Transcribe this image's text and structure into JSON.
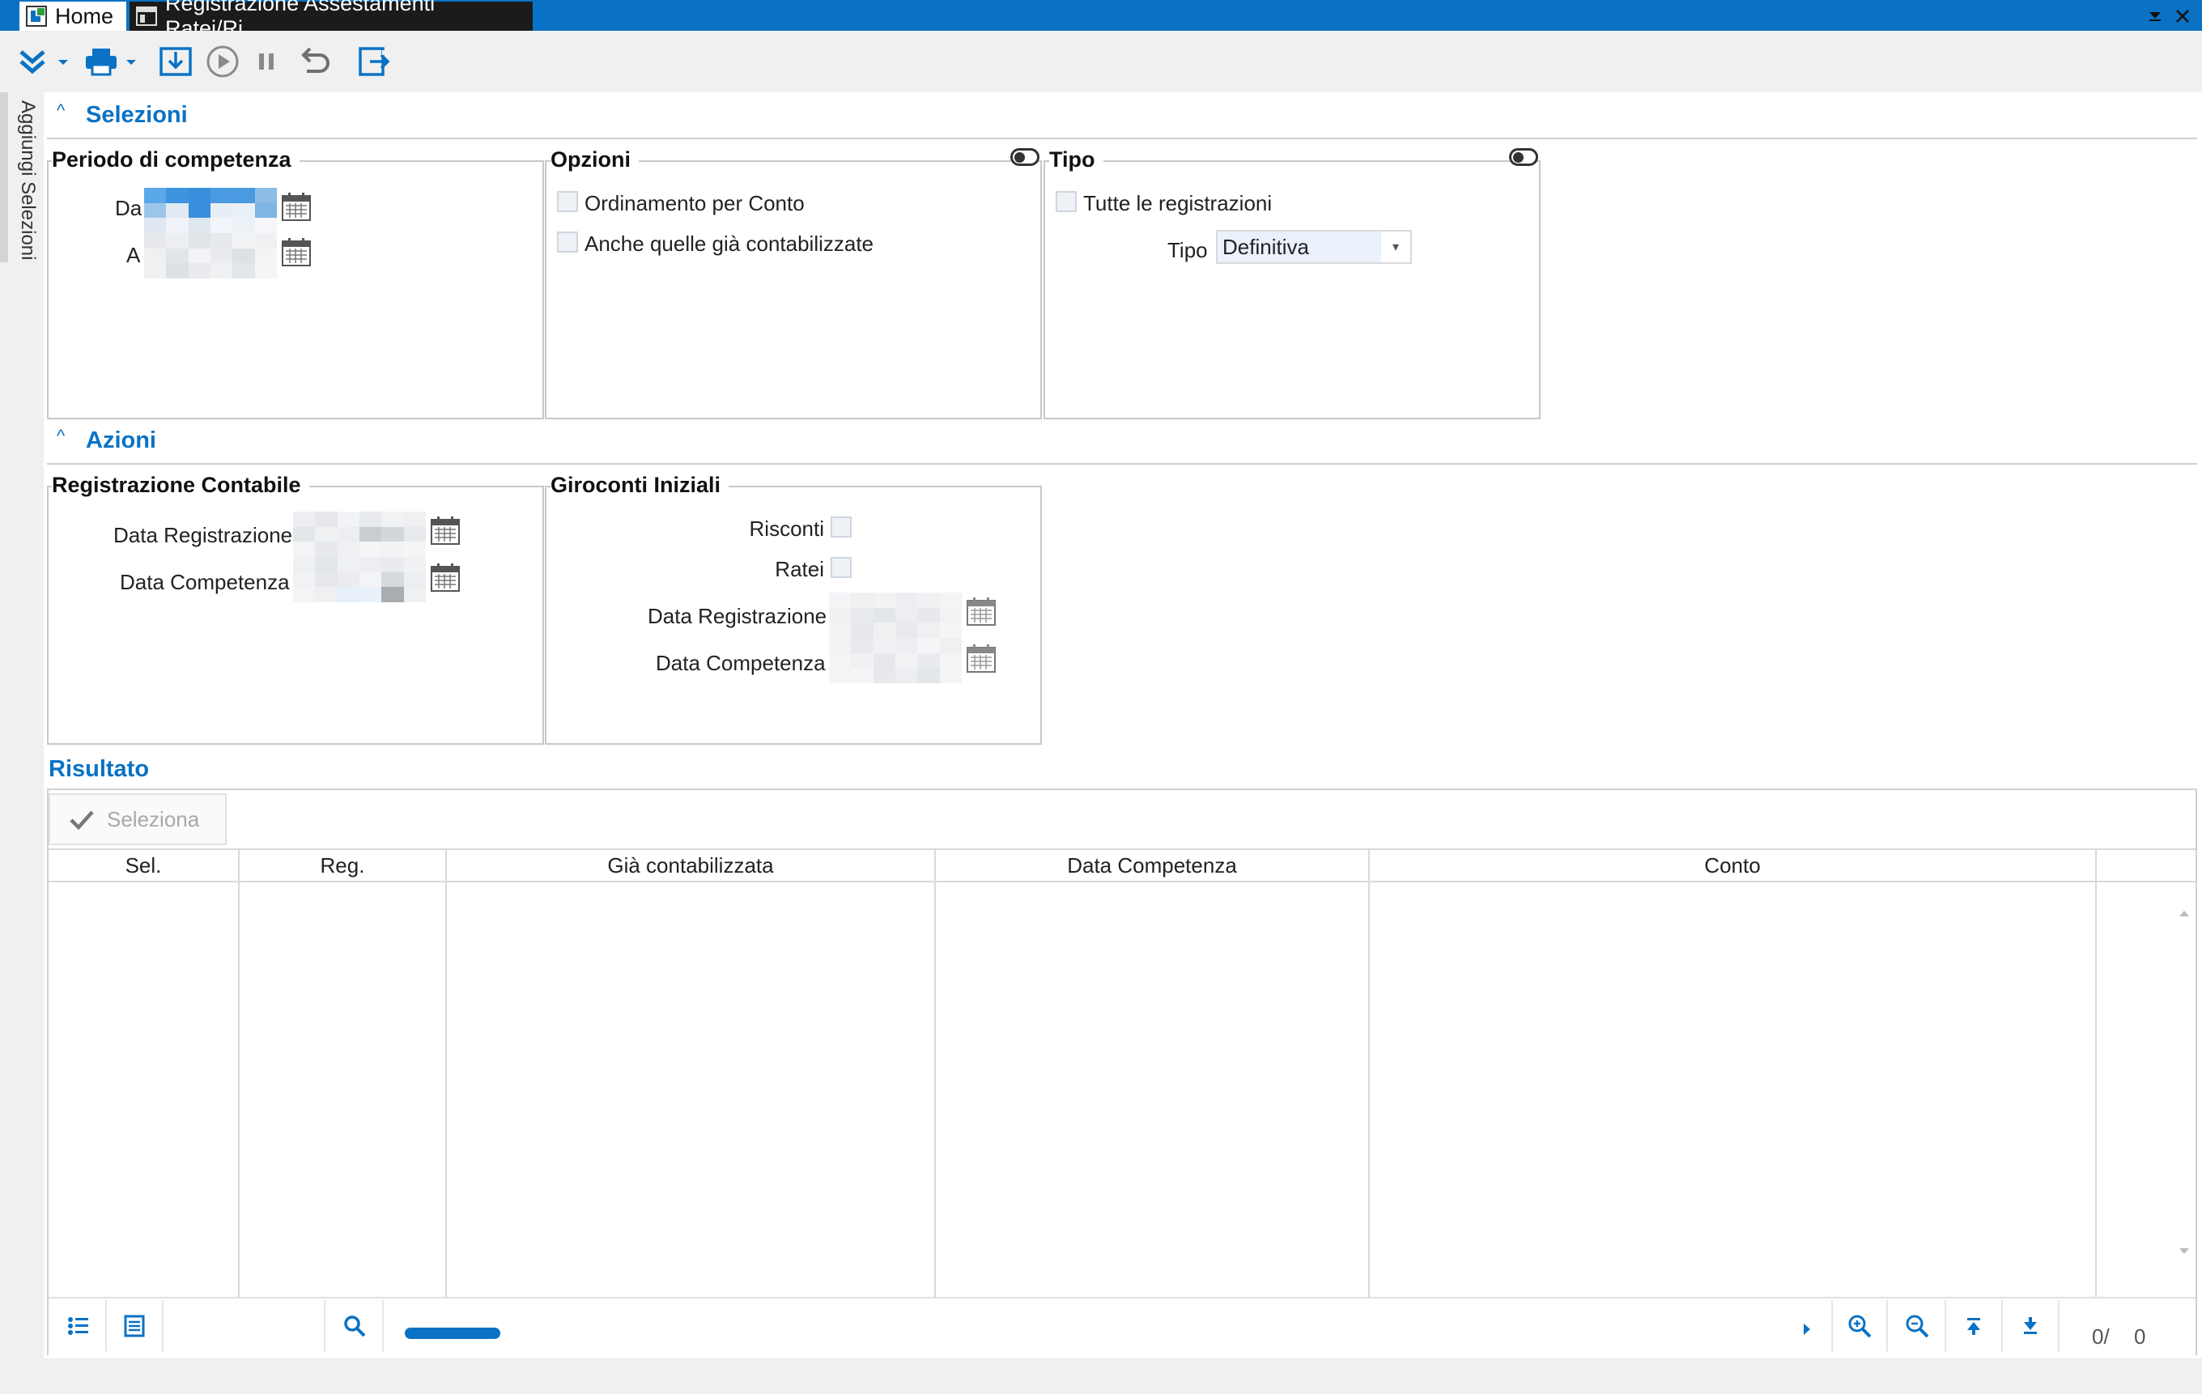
{
  "window": {
    "tabs": [
      {
        "label": "Home"
      },
      {
        "label": "Registrazione Assestamenti Ratei/Ri..."
      }
    ]
  },
  "sidebar": {
    "vertical_label": "Aggiungi Selezioni"
  },
  "selezioni": {
    "title": "Selezioni",
    "periodo": {
      "title": "Periodo di competenza",
      "from_label": "Da",
      "to_label": "A"
    },
    "opzioni": {
      "title": "Opzioni",
      "ordinamento_label": "Ordinamento per Conto",
      "anche_label": "Anche quelle già contabilizzate"
    },
    "tipo": {
      "title": "Tipo",
      "tutte_label": "Tutte le registrazioni",
      "tipo_label": "Tipo",
      "tipo_value": "Definitiva"
    }
  },
  "azioni": {
    "title": "Azioni",
    "registrazione": {
      "title": "Registrazione Contabile",
      "data_reg_label": "Data Registrazione",
      "data_comp_label": "Data Competenza"
    },
    "giroconti": {
      "title": "Giroconti Iniziali",
      "risconti_label": "Risconti",
      "ratei_label": "Ratei",
      "data_reg_label": "Data Registrazione",
      "data_comp_label": "Data Competenza"
    }
  },
  "risultato": {
    "title": "Risultato",
    "seleziona_label": "Seleziona",
    "columns": [
      "Sel.",
      "Reg.",
      "Già contabilizzata",
      "Data Competenza",
      "Conto"
    ],
    "counter": "0/",
    "total": "0"
  },
  "colors": {
    "accent": "#0a72c4",
    "titlebar": "#0a72c4"
  }
}
